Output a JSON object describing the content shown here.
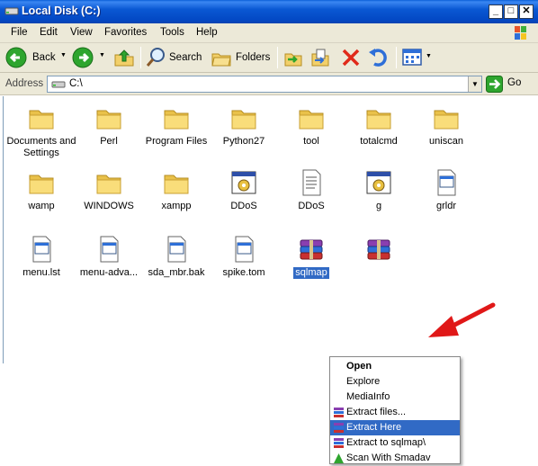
{
  "window": {
    "title": "Local Disk (C:)"
  },
  "menu": [
    "File",
    "Edit",
    "View",
    "Favorites",
    "Tools",
    "Help"
  ],
  "toolbar": {
    "back": "Back",
    "search": "Search",
    "folders": "Folders"
  },
  "address": {
    "label": "Address",
    "value": "C:\\",
    "go": "Go"
  },
  "items": [
    {
      "name": "Documents and Settings",
      "type": "folder"
    },
    {
      "name": "Perl",
      "type": "folder"
    },
    {
      "name": "Program Files",
      "type": "folder"
    },
    {
      "name": "Python27",
      "type": "folder"
    },
    {
      "name": "tool",
      "type": "folder"
    },
    {
      "name": "totalcmd",
      "type": "folder"
    },
    {
      "name": "uniscan",
      "type": "folder"
    },
    {
      "name": "wamp",
      "type": "folder"
    },
    {
      "name": "WINDOWS",
      "type": "folder"
    },
    {
      "name": "xampp",
      "type": "folder"
    },
    {
      "name": "DDoS",
      "type": "application"
    },
    {
      "name": "DDoS",
      "type": "text-document"
    },
    {
      "name": "g",
      "type": "application"
    },
    {
      "name": "grldr",
      "type": "file"
    },
    {
      "name": "menu.lst",
      "type": "file"
    },
    {
      "name": "menu-adva...",
      "type": "file"
    },
    {
      "name": "sda_mbr.bak",
      "type": "file"
    },
    {
      "name": "spike.tom",
      "type": "file"
    },
    {
      "name": "sqlmap",
      "type": "rar-archive",
      "selected": true
    },
    {
      "name": "",
      "type": "rar-archive"
    }
  ],
  "context_menu": [
    {
      "label": "Open",
      "bold": true
    },
    {
      "label": "Explore"
    },
    {
      "label": "MediaInfo"
    },
    {
      "label": "Extract files...",
      "icon": "winrar-icon"
    },
    {
      "label": "Extract Here",
      "icon": "winrar-icon",
      "highlighted": true
    },
    {
      "label": "Extract to sqlmap\\",
      "icon": "winrar-icon"
    },
    {
      "label": "Scan With Smadav",
      "icon": "smadav-icon"
    }
  ],
  "colors": {
    "titlebar": "#0a58d3",
    "selection": "#316ac5",
    "annotation_arrow": "#e01818",
    "chrome": "#ece9d8"
  }
}
